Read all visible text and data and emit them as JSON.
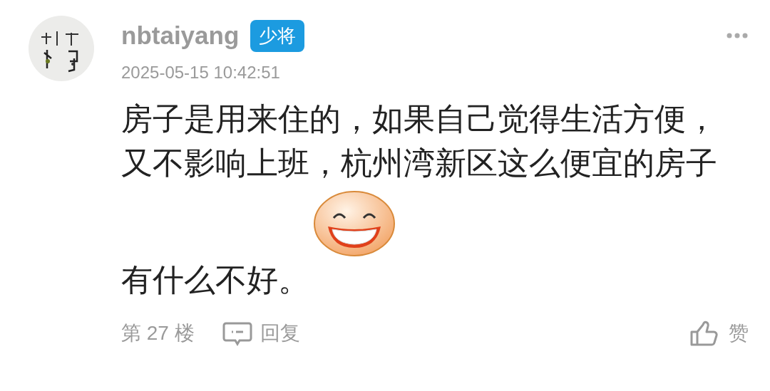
{
  "user": {
    "name": "nbtaiyang",
    "badge": "少将",
    "time": "2025-05-15 10:42:51"
  },
  "content": [
    {
      "kind": "text",
      "text": "房子是用来住的，如果自己觉得生活方便，又不影响上班，杭州湾新区这么便宜的房子"
    },
    {
      "kind": "emoji"
    },
    {
      "kind": "text",
      "text": "有什么不好。"
    }
  ],
  "footer": {
    "floor": "第 27 楼",
    "reply": "回复",
    "like": "赞"
  }
}
